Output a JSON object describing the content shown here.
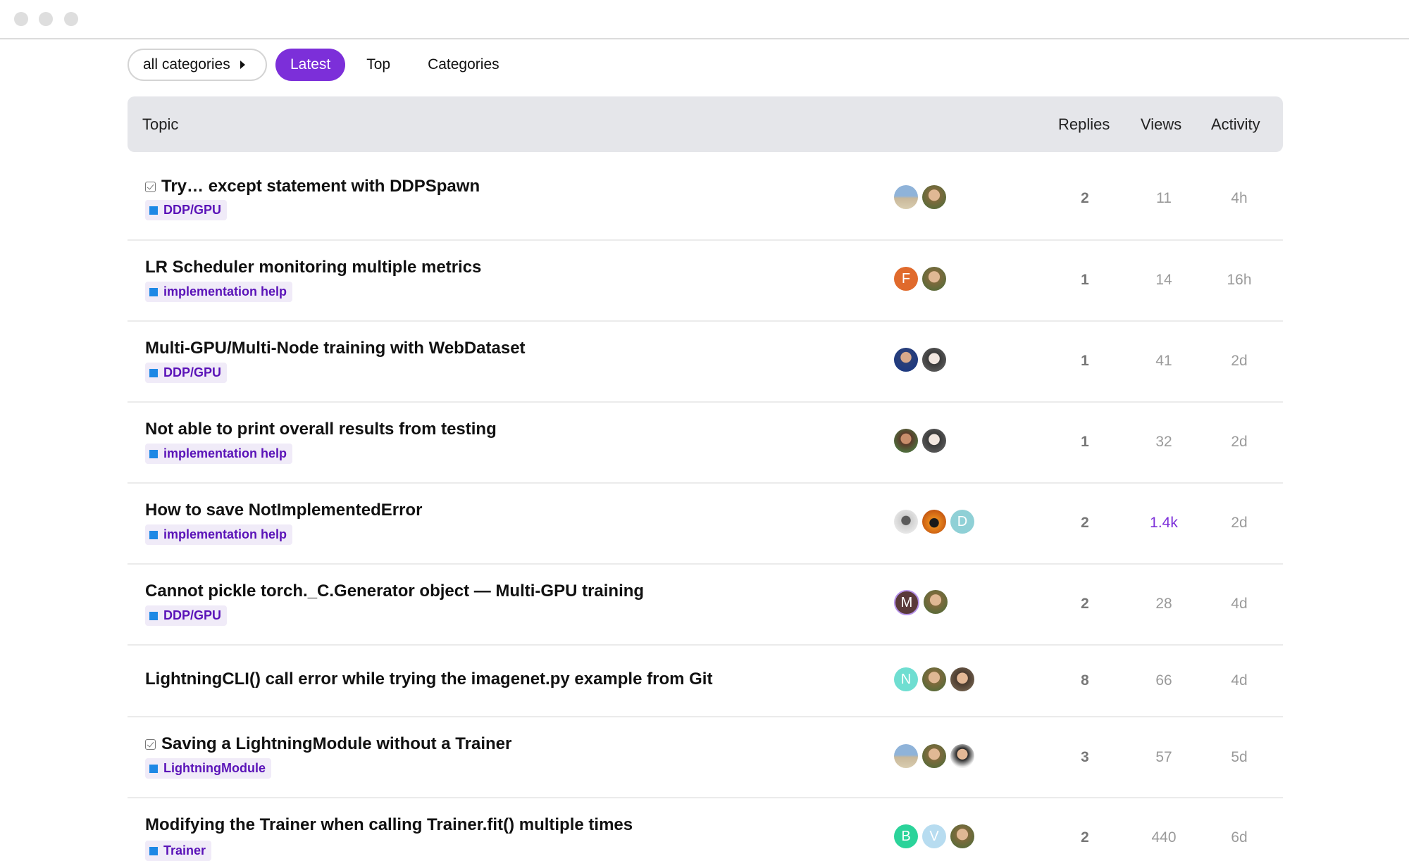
{
  "window": {
    "controls": [
      "close",
      "minimize",
      "maximize"
    ]
  },
  "nav": {
    "category_filter": "all categories",
    "latest": "Latest",
    "top": "Top",
    "categories": "Categories",
    "accent_color": "#7c2fd9"
  },
  "table": {
    "headers": {
      "topic": "Topic",
      "replies": "Replies",
      "views": "Views",
      "activity": "Activity"
    },
    "rows": [
      {
        "title": "Try… except statement with DDPSpawn",
        "solved": true,
        "category": "DDP/GPU",
        "replies": "2",
        "views": "11",
        "activity": "4h"
      },
      {
        "title": "LR Scheduler monitoring multiple metrics",
        "solved": false,
        "category": "implementation help",
        "replies": "1",
        "views": "14",
        "activity": "16h"
      },
      {
        "title": "Multi-GPU/Multi-Node training with WebDataset",
        "solved": false,
        "category": "DDP/GPU",
        "replies": "1",
        "views": "41",
        "activity": "2d"
      },
      {
        "title": "Not able to print overall results from testing",
        "solved": false,
        "category": "implementation help",
        "replies": "1",
        "views": "32",
        "activity": "2d"
      },
      {
        "title": "How to save NotImplementedError",
        "solved": false,
        "category": "implementation help",
        "replies": "2",
        "views": "1.4k",
        "activity": "2d"
      },
      {
        "title": "Cannot pickle torch._C.Generator object — Multi-GPU training",
        "solved": false,
        "category": "DDP/GPU",
        "replies": "2",
        "views": "28",
        "activity": "4d"
      },
      {
        "title": "LightningCLI() call error while trying the imagenet.py example from Git",
        "solved": false,
        "category": "",
        "replies": "8",
        "views": "66",
        "activity": "4d"
      },
      {
        "title": "Saving a LightningModule without a Trainer",
        "solved": true,
        "category": "LightningModule",
        "replies": "3",
        "views": "57",
        "activity": "5d"
      },
      {
        "title": "Modifying the Trainer when calling Trainer.fit() multiple times",
        "solved": false,
        "category": "Trainer",
        "replies": "2",
        "views": "440",
        "activity": "6d"
      }
    ]
  },
  "avatar_letters": {
    "f": "F",
    "d": "D",
    "m": "M",
    "n": "N",
    "b": "B",
    "v": "V"
  },
  "colors": {
    "category_square": "#1e88e5",
    "hot_views": "#7c2fd9"
  }
}
